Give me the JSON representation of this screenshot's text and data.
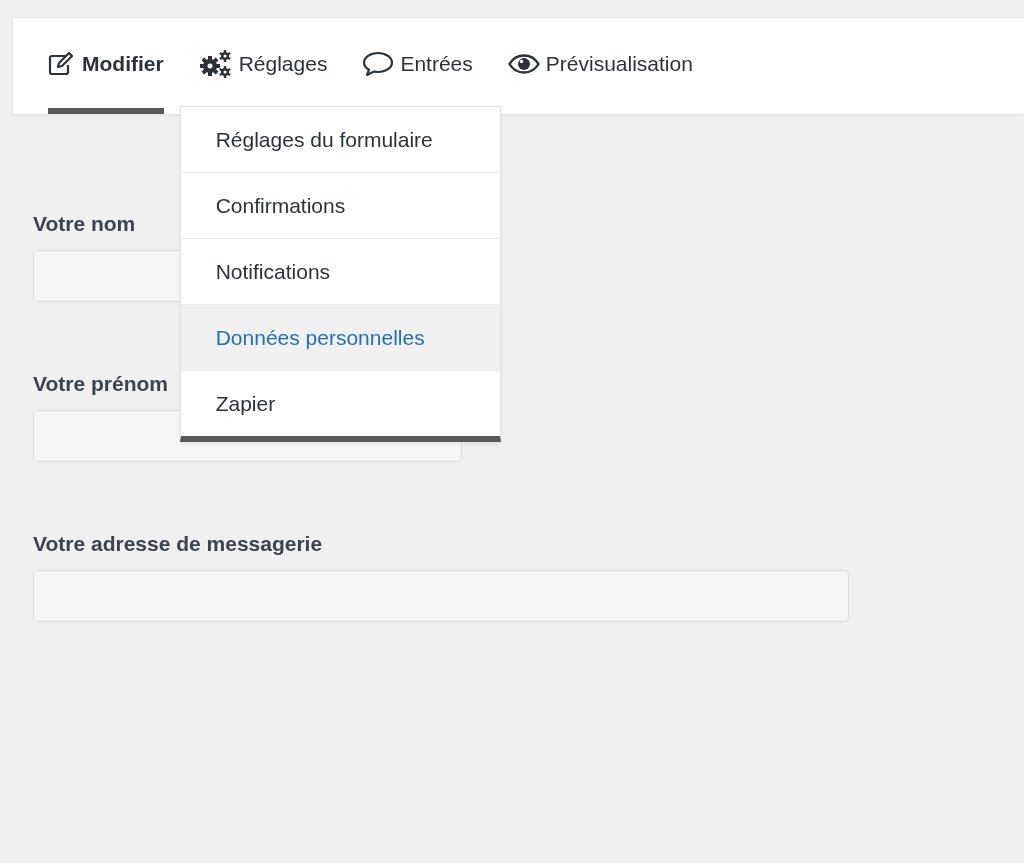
{
  "tabs": [
    {
      "label": "Modifier",
      "kind": "edit",
      "selected": true
    },
    {
      "label": "Réglages",
      "kind": "settings",
      "selected": false
    },
    {
      "label": "Entrées",
      "kind": "entries",
      "selected": false
    },
    {
      "label": "Prévisualisation",
      "kind": "preview",
      "selected": false
    }
  ],
  "settings_menu": {
    "expanded": true,
    "items": [
      {
        "label": "Réglages du formulaire",
        "selected": false
      },
      {
        "label": "Confirmations",
        "selected": false
      },
      {
        "label": "Notifications",
        "selected": false
      },
      {
        "label": "Données personnelles",
        "selected": true
      },
      {
        "label": "Zapier",
        "selected": false
      }
    ]
  },
  "form": {
    "fields": [
      {
        "label": "Votre nom",
        "kind": "short"
      },
      {
        "label": "Votre prénom",
        "kind": "short"
      },
      {
        "label": "Votre adresse de messagerie",
        "kind": "long"
      }
    ]
  }
}
